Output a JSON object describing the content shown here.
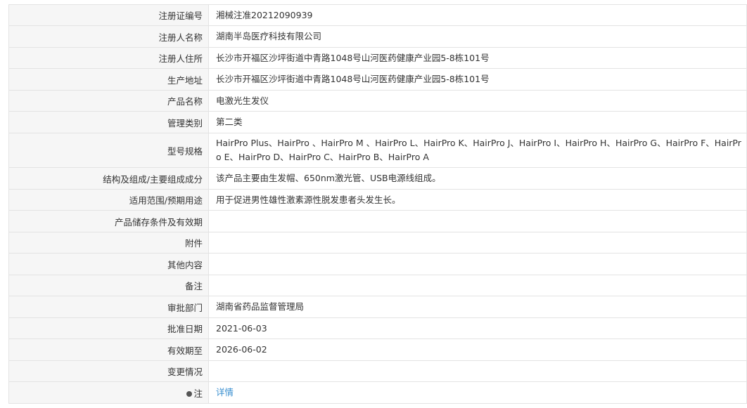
{
  "rows": [
    {
      "label": "注册证编号",
      "value": "湘械注准20212090939"
    },
    {
      "label": "注册人名称",
      "value": "湖南半岛医疗科技有限公司"
    },
    {
      "label": "注册人住所",
      "value": "长沙市开福区沙坪街道中青路1048号山河医药健康产业园5-8栋101号"
    },
    {
      "label": "生产地址",
      "value": "长沙市开福区沙坪街道中青路1048号山河医药健康产业园5-8栋101号"
    },
    {
      "label": "产品名称",
      "value": "电激光生发仪"
    },
    {
      "label": "管理类别",
      "value": "第二类"
    },
    {
      "label": "型号规格",
      "value": "HairPro Plus、HairPro 、HairPro M 、HairPro L、HairPro K、HairPro J、HairPro I、HairPro H、HairPro G、HairPro F、HairPro E、HairPro D、HairPro C、HairPro B、HairPro A"
    },
    {
      "label": "结构及组成/主要组成成分",
      "value": "该产品主要由生发帽、650nm激光管、USB电源线组成。"
    },
    {
      "label": "适用范围/预期用途",
      "value": "用于促进男性雄性激素源性脱发患者头发生长。"
    },
    {
      "label": "产品储存条件及有效期",
      "value": ""
    },
    {
      "label": "附件",
      "value": ""
    },
    {
      "label": "其他内容",
      "value": ""
    },
    {
      "label": "备注",
      "value": ""
    },
    {
      "label": "审批部门",
      "value": "湖南省药品监督管理局"
    },
    {
      "label": "批准日期",
      "value": "2021-06-03"
    },
    {
      "label": "有效期至",
      "value": "2026-06-02"
    },
    {
      "label": "变更情况",
      "value": ""
    },
    {
      "label": "注",
      "value": "详情"
    }
  ],
  "colors": {
    "label_bg": "#f6f6f6",
    "border": "#e3e3e3",
    "link": "#3a8fd0",
    "text": "#333333"
  },
  "icons": {
    "note": "bullet-dot-icon"
  }
}
